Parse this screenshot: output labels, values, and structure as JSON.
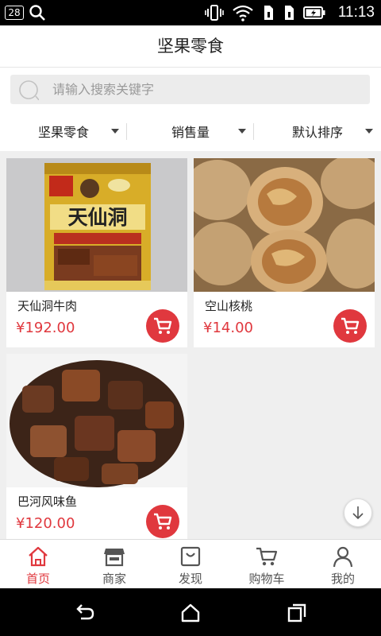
{
  "status_bar": {
    "badge": "28",
    "time": "11:13"
  },
  "title": "坚果零食",
  "search": {
    "placeholder": "请输入搜索关键字"
  },
  "filters": [
    {
      "label": "坚果零食"
    },
    {
      "label": "销售量"
    },
    {
      "label": "默认排序"
    }
  ],
  "products": [
    {
      "name": "天仙洞牛肉",
      "price": "¥192.00",
      "package_text": "天仙洞"
    },
    {
      "name": "空山核桃",
      "price": "¥14.00"
    },
    {
      "name": "巴河风味鱼",
      "price": "¥120.00"
    }
  ],
  "bottom_nav": [
    {
      "label": "首页",
      "icon": "home-icon",
      "active": true
    },
    {
      "label": "商家",
      "icon": "store-icon"
    },
    {
      "label": "发现",
      "icon": "discover-icon"
    },
    {
      "label": "购物车",
      "icon": "cart-icon"
    },
    {
      "label": "我的",
      "icon": "user-icon"
    }
  ],
  "colors": {
    "accent": "#e0383e",
    "background": "#f2f2f2"
  }
}
